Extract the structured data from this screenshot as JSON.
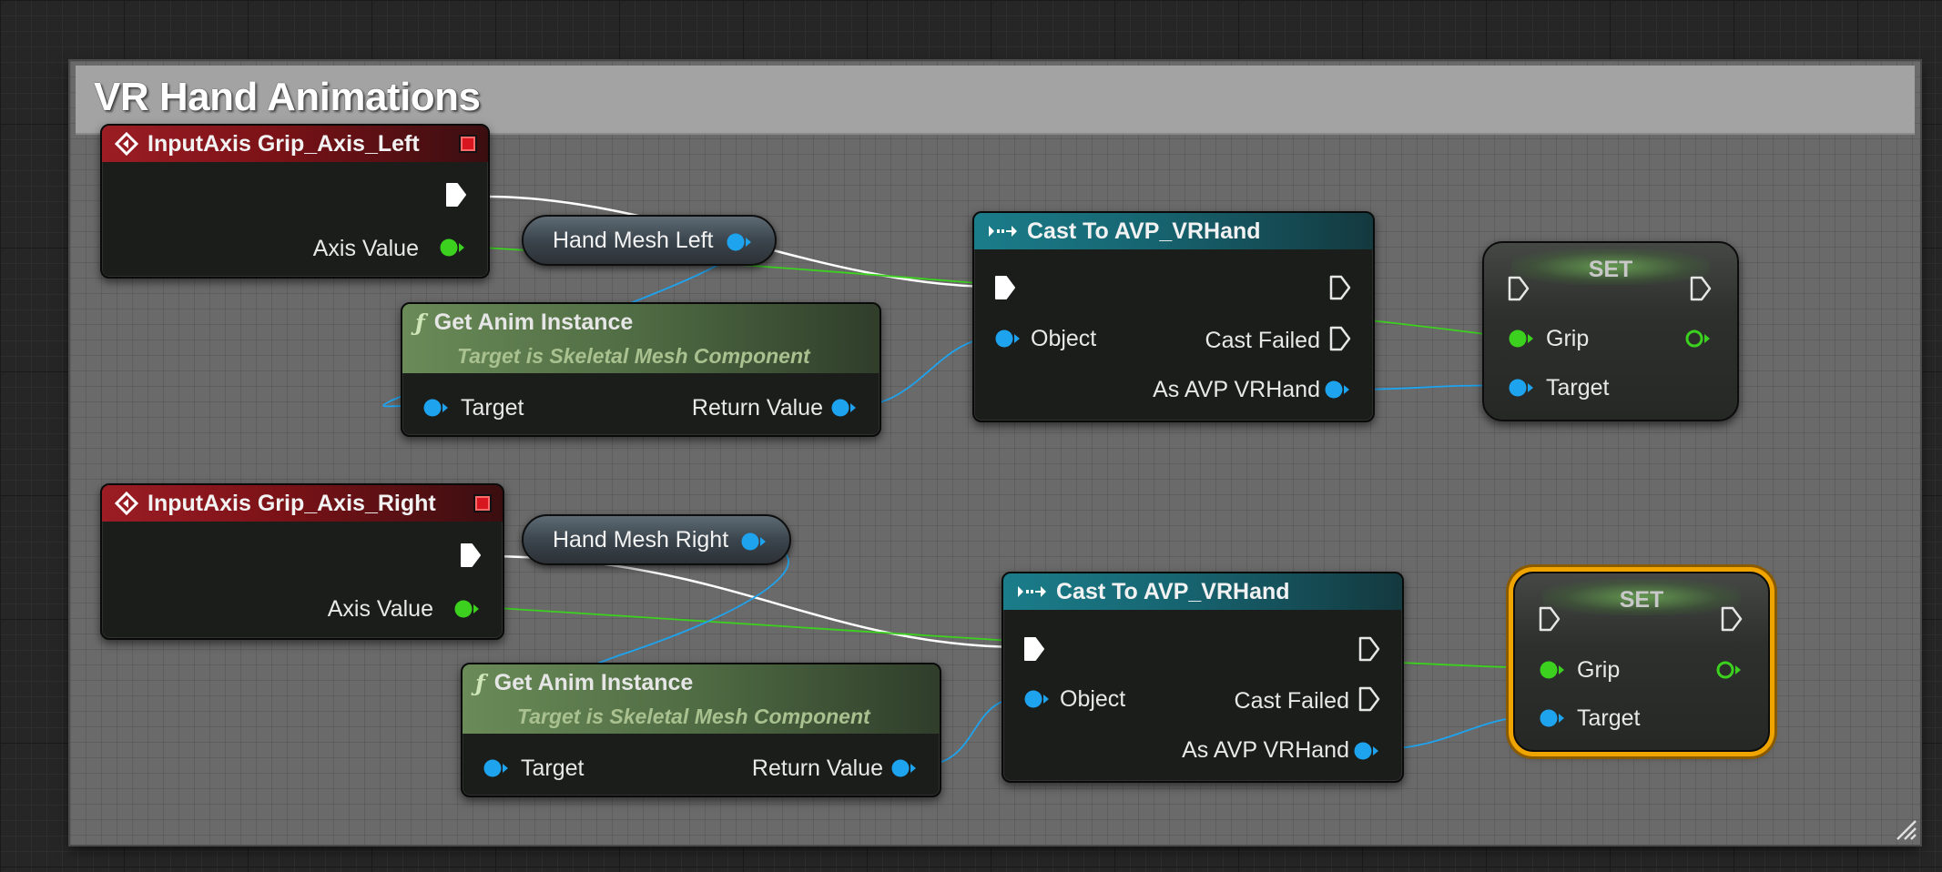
{
  "comment": {
    "title": "VR Hand Animations"
  },
  "colors": {
    "exec_pin": "#ffffff",
    "float_pin": "#3cd11f",
    "object_pin": "#1ea3ee",
    "event_header": "#9c1d24",
    "cast_header": "#1b7d8a",
    "function_header": "#6a8b58",
    "selection": "#f0a400"
  },
  "row_left": {
    "event": {
      "title": "InputAxis Grip_Axis_Left",
      "icon": "event-diamond-icon",
      "axis_label": "Axis Value"
    },
    "variable": {
      "label": "Hand Mesh Left"
    },
    "get_anim": {
      "title": "Get Anim Instance",
      "icon": "function-icon",
      "subtitle": "Target is Skeletal Mesh Component",
      "target_label": "Target",
      "return_label": "Return Value"
    },
    "cast": {
      "title": "Cast To AVP_VRHand",
      "icon": "cast-icon",
      "object_label": "Object",
      "failed_label": "Cast Failed",
      "as_label": "As AVP VRHand"
    },
    "set": {
      "title": "SET",
      "grip_label": "Grip",
      "target_label": "Target",
      "selected": false
    }
  },
  "row_right": {
    "event": {
      "title": "InputAxis Grip_Axis_Right",
      "icon": "event-diamond-icon",
      "axis_label": "Axis Value"
    },
    "variable": {
      "label": "Hand Mesh Right"
    },
    "get_anim": {
      "title": "Get Anim Instance",
      "icon": "function-icon",
      "subtitle": "Target is Skeletal Mesh Component",
      "target_label": "Target",
      "return_label": "Return Value"
    },
    "cast": {
      "title": "Cast To AVP_VRHand",
      "icon": "cast-icon",
      "object_label": "Object",
      "failed_label": "Cast Failed",
      "as_label": "As AVP VRHand"
    },
    "set": {
      "title": "SET",
      "grip_label": "Grip",
      "target_label": "Target",
      "selected": true
    }
  }
}
